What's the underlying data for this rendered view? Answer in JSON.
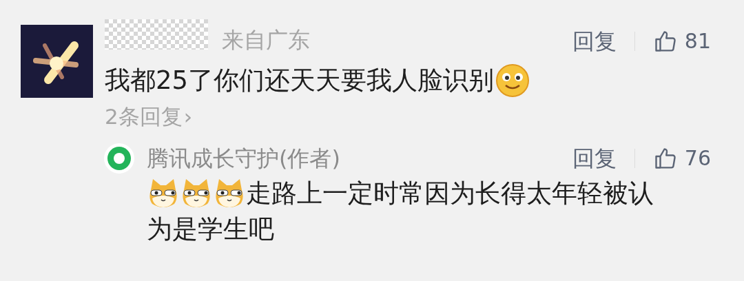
{
  "comment": {
    "location": "来自广东",
    "reply_label": "回复",
    "likes": "81",
    "text": "我都25了你们还天天要我人脸识别",
    "replies_link": "2条回复",
    "replies_arrow": "›"
  },
  "reply": {
    "author": "腾讯成长守护(作者)",
    "reply_label": "回复",
    "likes": "76",
    "text_lines": [
      "走路上一定时常因为长得太年轻被认",
      "为是学生吧"
    ]
  }
}
